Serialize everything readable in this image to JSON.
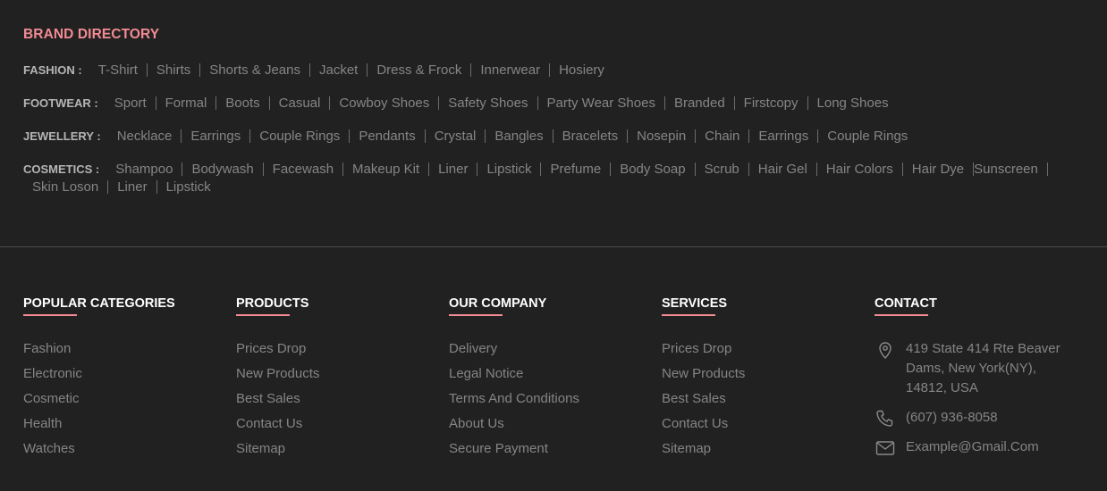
{
  "brand_directory": {
    "title": "BRAND DIRECTORY",
    "rows": [
      {
        "label": "FASHION :",
        "items": [
          "T-Shirt",
          "Shirts",
          "Shorts & Jeans",
          "Jacket",
          "Dress & Frock",
          "Innerwear",
          "Hosiery"
        ]
      },
      {
        "label": "FOOTWEAR :",
        "items": [
          "Sport",
          "Formal",
          "Boots",
          "Casual",
          "Cowboy Shoes",
          "Safety Shoes",
          "Party Wear Shoes",
          "Branded",
          "Firstcopy",
          "Long Shoes"
        ]
      },
      {
        "label": "JEWELLERY :",
        "items": [
          "Necklace",
          "Earrings",
          "Couple Rings",
          "Pendants",
          "Crystal",
          "Bangles",
          "Bracelets",
          "Nosepin",
          "Chain",
          "Earrings",
          "Couple Rings"
        ]
      },
      {
        "label": "COSMETICS :",
        "items": [
          "Shampoo",
          "Bodywash",
          "Facewash",
          "Makeup Kit",
          "Liner",
          "Lipstick",
          "Prefume",
          "Body Soap",
          "Scrub",
          "Hair Gel",
          "Hair Colors",
          "Hair Dye",
          "Sunscreen",
          "Skin Loson",
          "Liner",
          "Lipstick"
        ]
      }
    ]
  },
  "footer": {
    "popular_categories": {
      "title": "POPULAR CATEGORIES",
      "items": [
        "Fashion",
        "Electronic",
        "Cosmetic",
        "Health",
        "Watches"
      ]
    },
    "products": {
      "title": "PRODUCTS",
      "items": [
        "Prices Drop",
        "New Products",
        "Best Sales",
        "Contact Us",
        "Sitemap"
      ]
    },
    "our_company": {
      "title": "OUR COMPANY",
      "items": [
        "Delivery",
        "Legal Notice",
        "Terms And Conditions",
        "About Us",
        "Secure Payment"
      ]
    },
    "services": {
      "title": "SERVICES",
      "items": [
        "Prices Drop",
        "New Products",
        "Best Sales",
        "Contact Us",
        "Sitemap"
      ]
    },
    "contact": {
      "title": "CONTACT",
      "address": "419 State 414 Rte Beaver Dams, New York(NY), 14812, USA",
      "phone": "(607) 936-8058",
      "email": "Example@Gmail.Com"
    }
  },
  "colors": {
    "background": "#212121",
    "accent": "#f28b92",
    "heading": "#ffffff",
    "text": "#858585"
  },
  "icons": {
    "address": "location-pin-icon",
    "phone": "phone-icon",
    "email": "mail-icon"
  }
}
